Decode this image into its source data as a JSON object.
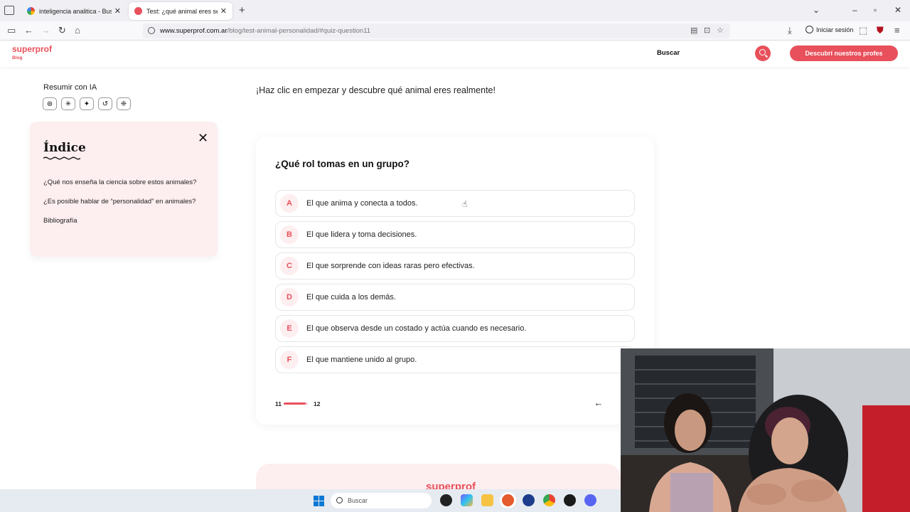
{
  "browser": {
    "tabs": [
      {
        "title": "inteligencia analitica - Buscar c",
        "active": false
      },
      {
        "title": "Test: ¿qué animal eres según tu",
        "active": true
      }
    ],
    "url_host": "www.superprof.com.ar",
    "url_path": "/blog/test-animal-personalidad/#quiz-question11",
    "signin_label": "Iniciar sesión"
  },
  "site": {
    "logo": "superprof",
    "logo_sub": "Blog",
    "search_label": "Buscar",
    "cta_label": "Descubrí nuestros profes",
    "accent_color": "#e8505b"
  },
  "sidebar": {
    "summary_label": "Resumir con IA",
    "ai_icons": [
      "openai-icon",
      "claude-icon",
      "gemini-icon",
      "perplexity-icon",
      "grok-icon"
    ],
    "index": {
      "title": "Índice",
      "items": [
        "¿Qué nos enseña la ciencia sobre estos animales?",
        "¿Es posible hablar de “personalidad” en animales?",
        "Bibliografía"
      ]
    }
  },
  "main": {
    "intro": "¡Haz clic en empezar y descubre qué animal eres realmente!",
    "quiz": {
      "question": "¿Qué rol tomas en un grupo?",
      "options": [
        {
          "letter": "A",
          "text": "El que anima y conecta a todos."
        },
        {
          "letter": "B",
          "text": "El que lidera y toma decisiones."
        },
        {
          "letter": "C",
          "text": "El que sorprende con ideas raras pero efectivas."
        },
        {
          "letter": "D",
          "text": "El que cuida a los demás."
        },
        {
          "letter": "E",
          "text": "El que observa desde un costado y actúa cuando es necesario."
        },
        {
          "letter": "F",
          "text": "El que mantiene unido al grupo."
        }
      ],
      "progress_current": "11",
      "progress_total": "12",
      "progress_fraction": 0.917
    },
    "footer_logo": "superprof"
  },
  "taskbar": {
    "search_placeholder": "Buscar"
  }
}
